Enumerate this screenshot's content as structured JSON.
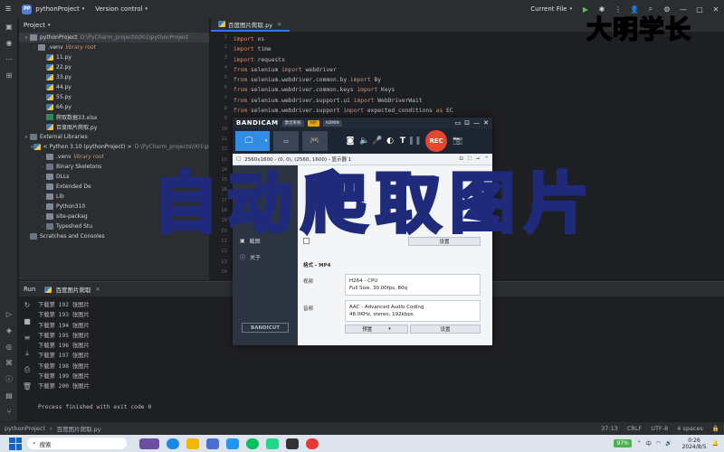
{
  "titlebar": {
    "project_badge": "PP",
    "project_name": "pythonProject",
    "vcs": "Version control",
    "run_config": "Current File"
  },
  "project_panel": {
    "title": "Project",
    "rows": [
      {
        "indent": 0,
        "arrow": "▾",
        "icon": "folder",
        "label": "pythonProject",
        "extra": "D:\\PyCharm_projects\\001\\pythonProject",
        "extra_style": "dim",
        "selected": true
      },
      {
        "indent": 1,
        "arrow": "›",
        "icon": "folder",
        "label": ".venv",
        "extra": "library root",
        "extra_style": "excl"
      },
      {
        "indent": 2,
        "arrow": "",
        "icon": "py",
        "label": "11.py"
      },
      {
        "indent": 2,
        "arrow": "",
        "icon": "py",
        "label": "22.py"
      },
      {
        "indent": 2,
        "arrow": "",
        "icon": "py",
        "label": "33.py"
      },
      {
        "indent": 2,
        "arrow": "",
        "icon": "py",
        "label": "44.py"
      },
      {
        "indent": 2,
        "arrow": "",
        "icon": "py",
        "label": "55.py"
      },
      {
        "indent": 2,
        "arrow": "",
        "icon": "py",
        "label": "66.py"
      },
      {
        "indent": 2,
        "arrow": "",
        "icon": "xls",
        "label": "爬取数据33.xlsx"
      },
      {
        "indent": 2,
        "arrow": "",
        "icon": "py",
        "label": "百度图片爬取.py"
      },
      {
        "indent": 0,
        "arrow": "▾",
        "icon": "lib",
        "label": "External Libraries"
      },
      {
        "indent": 1,
        "arrow": "▾",
        "icon": "py",
        "label": "< Python 3.10 (pythonProject) >",
        "extra": "D:\\PyCharm_projects\\001\\pytho",
        "extra_style": "dim"
      },
      {
        "indent": 2,
        "arrow": "›",
        "icon": "folder",
        "label": ".venv",
        "extra": "library root",
        "extra_style": "excl"
      },
      {
        "indent": 2,
        "arrow": "›",
        "icon": "lib",
        "label": "Binary Skeletons"
      },
      {
        "indent": 2,
        "arrow": "›",
        "icon": "folder",
        "label": "DLLs"
      },
      {
        "indent": 2,
        "arrow": "›",
        "icon": "folder",
        "label": "Extended De"
      },
      {
        "indent": 2,
        "arrow": "›",
        "icon": "folder",
        "label": "Lib"
      },
      {
        "indent": 2,
        "arrow": "›",
        "icon": "folder",
        "label": "Python310"
      },
      {
        "indent": 2,
        "arrow": "›",
        "icon": "folder",
        "label": "site-packag"
      },
      {
        "indent": 2,
        "arrow": "›",
        "icon": "lib",
        "label": "Typeshed Stu"
      },
      {
        "indent": 0,
        "arrow": "",
        "icon": "lib",
        "label": "Scratches and Consoles"
      }
    ]
  },
  "editor": {
    "tab": "百度图片爬取.py",
    "line_numbers": [
      "1",
      "2",
      "3",
      "4",
      "5",
      "6",
      "7",
      "8",
      "9",
      "10",
      "11",
      "12",
      "13",
      "14",
      "15",
      "16",
      "17",
      "18",
      "19",
      "20",
      "21",
      "22",
      "23",
      "24"
    ],
    "lines": [
      {
        "kw": "import",
        "rest": " os"
      },
      {
        "kw": "import",
        "rest": " time"
      },
      {
        "kw": "import",
        "rest": " requests"
      },
      {
        "kw": "from",
        "rest": " selenium ",
        "kw2": "import",
        "rest2": " webdriver"
      },
      {
        "kw": "from",
        "rest": " selenium.webdriver.common.by ",
        "kw2": "import",
        "rest2": " By"
      },
      {
        "kw": "from",
        "rest": " selenium.webdriver.common.keys ",
        "kw2": "import",
        "rest2": " Keys"
      },
      {
        "kw": "from",
        "rest": " selenium.webdriver.support.ui ",
        "kw2": "import",
        "rest2": " WebDriverWait"
      },
      {
        "kw": "from",
        "rest": " selenium.webdriver.support ",
        "kw2": "import",
        "rest2": " expected_conditions ",
        "kw3": "as",
        "rest3": " EC"
      },
      {
        "kw": "from",
        "rest": " selenium.webdriver.chrome.service ",
        "kw2": "import",
        "rest2": " Service"
      }
    ]
  },
  "run_panel": {
    "title": "Run",
    "tab": "百度图片爬取",
    "output": [
      "下载第 192 张图片",
      "下载第 193 张图片",
      "下载第 194 张图片",
      "下载第 195 张图片",
      "下载第 196 张图片",
      "下载第 197 张图片",
      "下载第 198 张图片",
      "下载第 199 张图片",
      "下载第 200 张图片",
      "",
      "Process finished with exit code 0"
    ]
  },
  "statusbar": {
    "breadcrumb_project": "pythonProject",
    "breadcrumb_file": "百度图片爬取.py",
    "position": "37:13",
    "line_sep": "CRLF",
    "encoding": "UTF-8",
    "indent": "4 spaces"
  },
  "taskbar": {
    "search": "搜索",
    "battery": "97%",
    "ime": "中",
    "time": "0:26",
    "date": "2024/8/5"
  },
  "bandicam": {
    "logo": "BANDICAM",
    "tag1": "激活系统",
    "tag2": "VIP",
    "tag3": "ADMIN",
    "rec_label": "REC",
    "resolution": "2560x1600 - (0, 0), (2560, 1600) - 显示器 1",
    "nav": [
      "截图",
      "关于"
    ],
    "format_label": "格式 - MP4",
    "video_label": "视频",
    "video_codec": "H264 - CPU",
    "video_detail": "Full Size, 30.00fps, 80q",
    "audio_label": "音频",
    "audio_codec": "AAC - Advanced Audio Coding",
    "audio_detail": "48.0KHz, stereo, 192kbps",
    "preset_button": "预置",
    "settings_button": "设置",
    "bandicut": "BANDICUT"
  },
  "overlay": {
    "watermark": "大明学长",
    "title": "自动爬取图片"
  }
}
